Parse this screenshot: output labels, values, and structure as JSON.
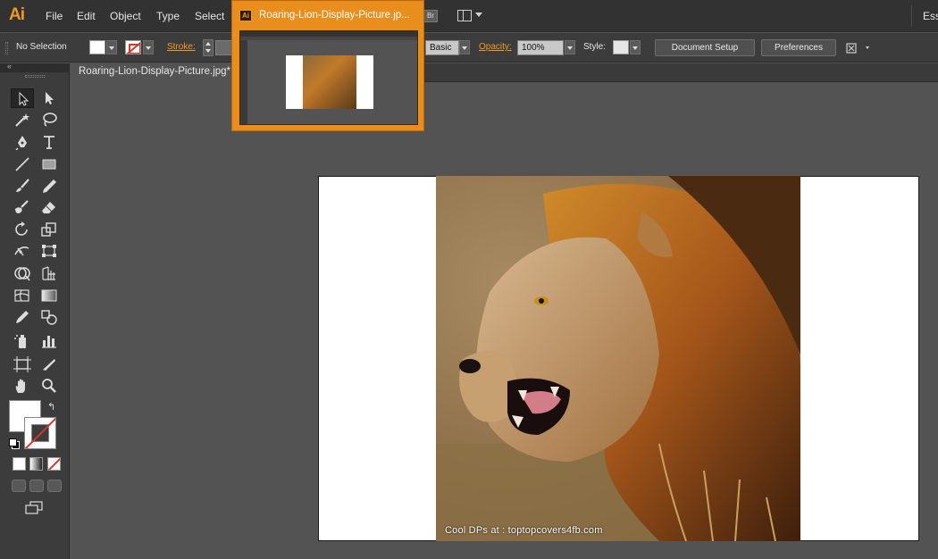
{
  "app": {
    "logo": "Ai",
    "menu": [
      "File",
      "Edit",
      "Object",
      "Type",
      "Select"
    ],
    "bridge_badge": "Br",
    "workspace_label": "Ess"
  },
  "document_switcher": {
    "title": "Roaring-Lion-Display-Picture.jp...",
    "icon_text": "Ai"
  },
  "control_bar": {
    "selection": "No Selection",
    "stroke_label": "Stroke:",
    "brush_value": "Basic",
    "opacity_label": "Opacity:",
    "opacity_value": "100%",
    "style_label": "Style:",
    "document_setup": "Document Setup",
    "preferences": "Preferences"
  },
  "document_tab": {
    "label": "Roaring-Lion-Display-Picture.jpg*"
  },
  "canvas": {
    "watermark": "Cool DPs at : toptopcovers4fb.com"
  },
  "colors": {
    "accent_orange": "#e98d1c",
    "ui_dark": "#3c3c3c",
    "canvas_gray": "#535353",
    "none_red": "#d03a2e"
  },
  "tools": [
    "selection-tool",
    "direct-selection-tool",
    "magic-wand-tool",
    "lasso-tool",
    "pen-tool",
    "type-tool",
    "line-segment-tool",
    "rectangle-tool",
    "paintbrush-tool",
    "pencil-tool",
    "blob-brush-tool",
    "eraser-tool",
    "rotate-tool",
    "scale-tool",
    "width-tool",
    "free-transform-tool",
    "shape-builder-tool",
    "perspective-grid-tool",
    "mesh-tool",
    "gradient-tool",
    "eyedropper-tool",
    "blend-tool",
    "symbol-sprayer-tool",
    "column-graph-tool",
    "artboard-tool",
    "slice-tool",
    "hand-tool",
    "zoom-tool"
  ]
}
